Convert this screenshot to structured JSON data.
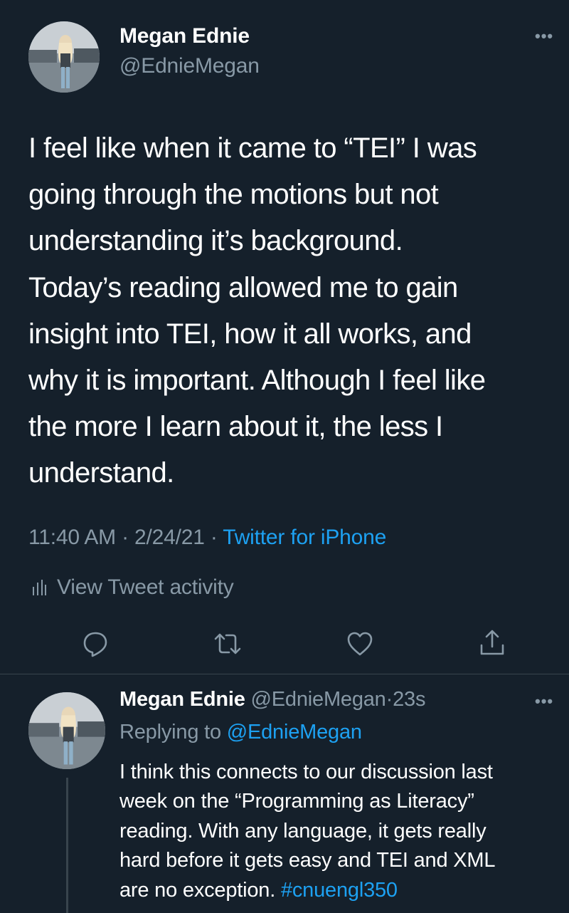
{
  "colors": {
    "background": "#15202b",
    "text_primary": "#ffffff",
    "text_secondary": "#8899a6",
    "link": "#1da1f2",
    "divider": "#38444d"
  },
  "main_tweet": {
    "author_name": "Megan Ednie",
    "author_handle": "@EdnieMegan",
    "more_icon": "more-horizontal-icon",
    "text": "I feel like when it came to “TEI” I was\ngoing through the motions but not\nunderstanding it’s background.\nToday’s reading allowed me to gain\ninsight into TEI, how it all works, and\nwhy it is important. Although I feel like\nthe more I learn about it, the less I\nunderstand.",
    "time": "11:40 AM",
    "separator": "·",
    "date": "2/24/21",
    "source": "Twitter for iPhone",
    "activity_label": "View Tweet activity",
    "actions": [
      "reply-icon",
      "retweet-icon",
      "like-icon",
      "share-icon"
    ]
  },
  "reply_tweet": {
    "author_name": "Megan Ednie",
    "author_handle": "@EdnieMegan",
    "separator": "·",
    "time_ago": "23s",
    "replying_prefix": "Replying to",
    "replying_handle": "@EdnieMegan",
    "text": "I think this connects to our discussion last\nweek on the “Programming as Literacy”\nreading. With any language, it gets really\nhard before it gets easy and TEI and XML\nare no exception.",
    "hashtag": "#cnuengl350"
  }
}
